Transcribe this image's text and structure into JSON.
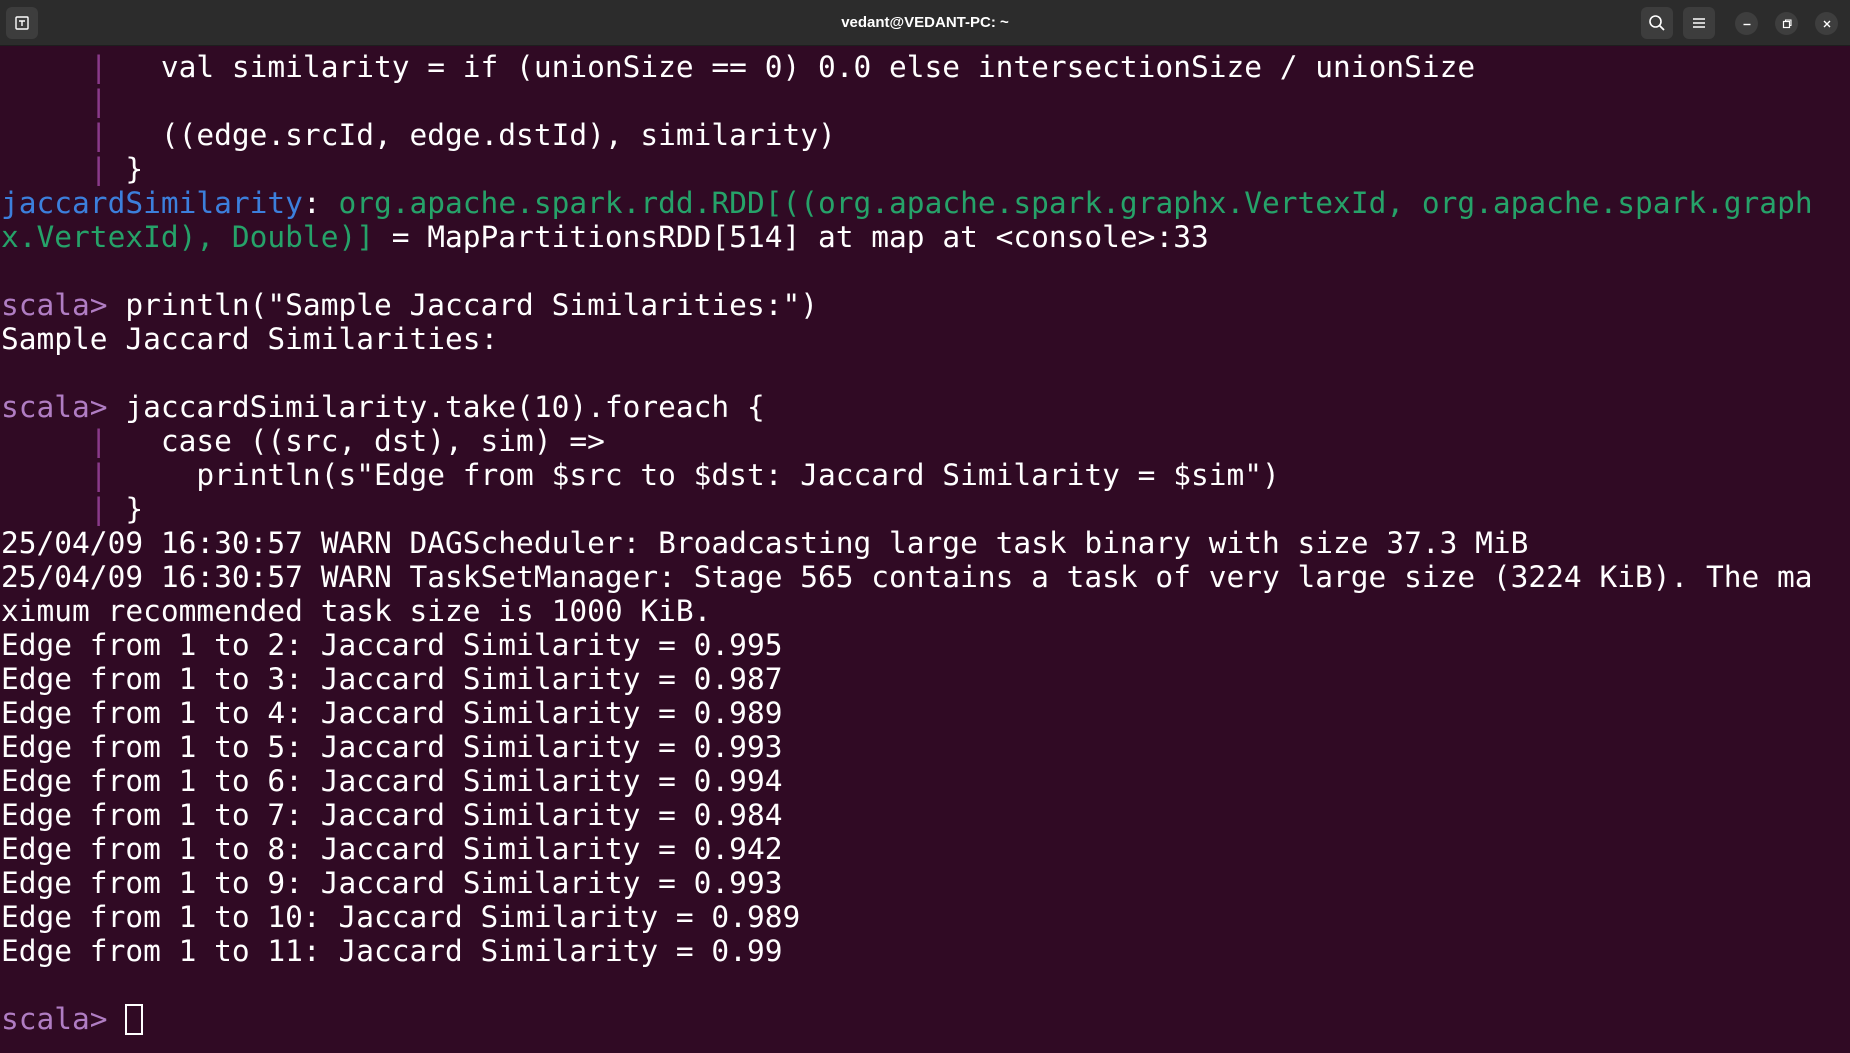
{
  "window": {
    "title": "vedant@VEDANT-PC: ~"
  },
  "titlebar": {
    "icons": [
      "new-tab-icon",
      "search-icon",
      "hamburger-menu-icon",
      "minimize-icon",
      "maximize-icon",
      "close-icon"
    ]
  },
  "terminal": {
    "continuation_prefix": "     | ",
    "prompt": "scala> ",
    "code_tail": [
      "  val similarity = if (unionSize == 0) 0.0 else intersectionSize / unionSize",
      "",
      "  ((edge.srcId, edge.dstId), similarity)",
      "}"
    ],
    "result": {
      "identifier": "jaccardSimilarity",
      "separator": ": ",
      "type_line1": "org.apache.spark.rdd.RDD[((org.apache.spark.graphx.VertexId, org.apache.spark.graph",
      "type_line2": "x.VertexId), Double)]",
      "value_tail": " = MapPartitionsRDD[514] at map at <console>:33"
    },
    "command1": "println(\"Sample Jaccard Similarities:\")",
    "output1": "Sample Jaccard Similarities:",
    "command2": "jaccardSimilarity.take(10).foreach {",
    "command2_cont": [
      "  case ((src, dst), sim) =>",
      "    println(s\"Edge from $src to $dst: Jaccard Similarity = $sim\")",
      "}"
    ],
    "warnings": [
      "25/04/09 16:30:57 WARN DAGScheduler: Broadcasting large task binary with size 37.3 MiB",
      "25/04/09 16:30:57 WARN TaskSetManager: Stage 565 contains a task of very large size (3224 KiB). The ma",
      "ximum recommended task size is 1000 KiB."
    ],
    "edges": [
      "Edge from 1 to 2: Jaccard Similarity = 0.995",
      "Edge from 1 to 3: Jaccard Similarity = 0.987",
      "Edge from 1 to 4: Jaccard Similarity = 0.989",
      "Edge from 1 to 5: Jaccard Similarity = 0.993",
      "Edge from 1 to 6: Jaccard Similarity = 0.994",
      "Edge from 1 to 7: Jaccard Similarity = 0.984",
      "Edge from 1 to 8: Jaccard Similarity = 0.942",
      "Edge from 1 to 9: Jaccard Similarity = 0.993",
      "Edge from 1 to 10: Jaccard Similarity = 0.989",
      "Edge from 1 to 11: Jaccard Similarity = 0.99"
    ]
  },
  "colors": {
    "background": "#300a24",
    "prompt": "#b07dc3",
    "identifier": "#3c7fdc",
    "type": "#26a269",
    "continuation_pipe": "#8a3a8a",
    "text": "#ffffff"
  }
}
